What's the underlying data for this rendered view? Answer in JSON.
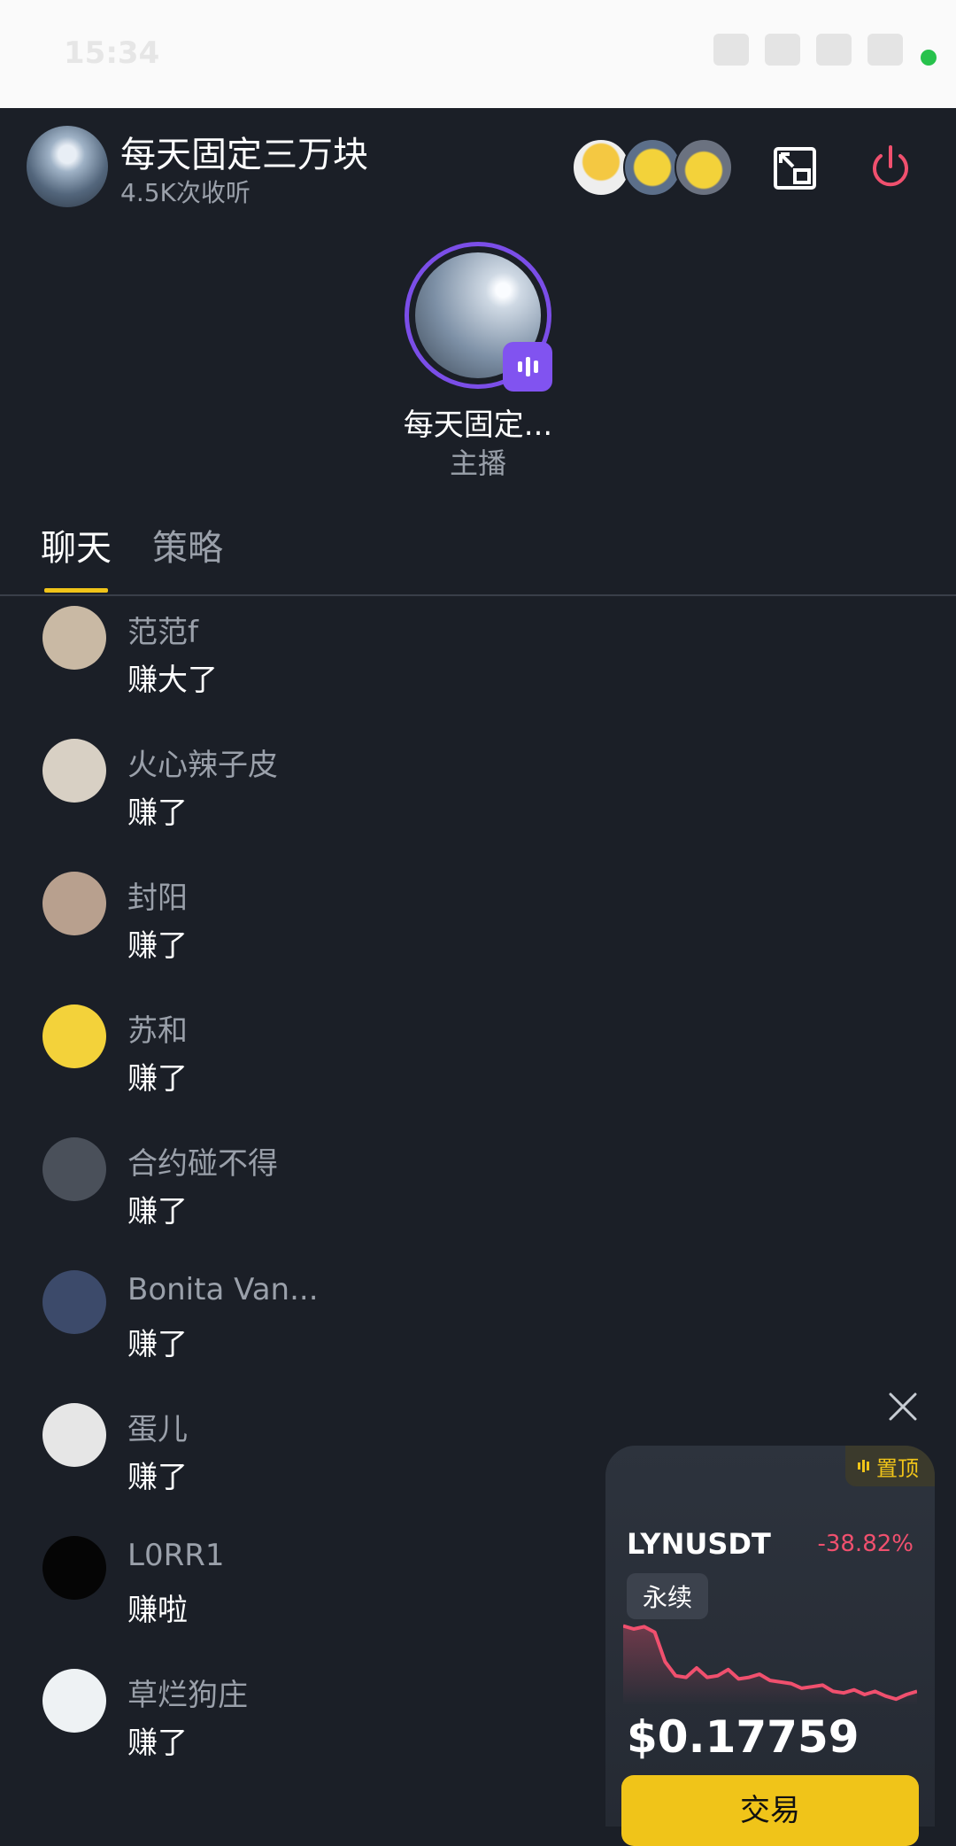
{
  "status_bar": {
    "time": "15:34"
  },
  "room": {
    "title": "每天固定三万块",
    "listens": "4.5K次收听"
  },
  "host": {
    "name": "每天固定...",
    "role": "主播"
  },
  "tabs": [
    {
      "label": "聊天"
    },
    {
      "label": "策略"
    }
  ],
  "messages": [
    {
      "user": "范范f",
      "text": "赚大了",
      "avatar_color": "#c9b9a4"
    },
    {
      "user": "火心辣子皮",
      "text": "赚了",
      "avatar_color": "#d8d0c4"
    },
    {
      "user": "封阳",
      "text": "赚了",
      "avatar_color": "#b8a08e"
    },
    {
      "user": "苏和",
      "text": "赚了",
      "avatar_color": "#f3d23a"
    },
    {
      "user": "合约碰不得",
      "text": "赚了",
      "avatar_color": "#4a505a"
    },
    {
      "user": "Bonita Van...",
      "text": "赚了",
      "avatar_color": "#3c4a6a"
    },
    {
      "user": "蛋儿",
      "text": "赚了",
      "avatar_color": "#e6e6e6"
    },
    {
      "user": "L0RR1",
      "text": "赚啦",
      "avatar_color": "#050505"
    },
    {
      "user": "草烂狗庄",
      "text": "赚了",
      "avatar_color": "#eef2f4"
    }
  ],
  "ticker": {
    "pin_label": "置顶",
    "symbol": "LYNUSDT",
    "change": "-38.82%",
    "contract_type": "永续",
    "price": "$0.17759",
    "trade_label": "交易",
    "line_color": "#f0506e",
    "sparkline": [
      0.96,
      0.92,
      0.95,
      0.88,
      0.5,
      0.32,
      0.3,
      0.42,
      0.3,
      0.32,
      0.4,
      0.28,
      0.3,
      0.34,
      0.26,
      0.24,
      0.22,
      0.16,
      0.18,
      0.2,
      0.12,
      0.1,
      0.14,
      0.08,
      0.12,
      0.06,
      0.02,
      0.08,
      0.12
    ]
  },
  "colors": {
    "background": "#1b1f27",
    "accent": "#f0c419",
    "host_ring": "#7b4ee8",
    "negative": "#f0506e"
  }
}
